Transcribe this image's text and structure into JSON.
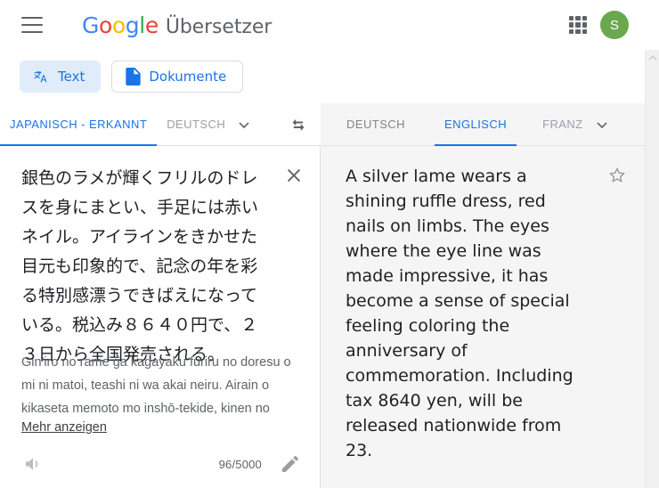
{
  "header": {
    "menu_icon": "hamburger-menu-icon",
    "logo_text": "Google",
    "logo_letters": [
      {
        "ch": "G",
        "color": "#4285f4"
      },
      {
        "ch": "o",
        "color": "#ea4335"
      },
      {
        "ch": "o",
        "color": "#fbbc05"
      },
      {
        "ch": "g",
        "color": "#4285f4"
      },
      {
        "ch": "l",
        "color": "#34a853"
      },
      {
        "ch": "e",
        "color": "#ea4335"
      }
    ],
    "product_name": "Übersetzer",
    "apps_icon": "apps-grid-icon",
    "avatar_initial": "S",
    "avatar_color": "#6aa84f"
  },
  "mode_tabs": [
    {
      "label": "Text",
      "icon": "translate-icon",
      "active": true
    },
    {
      "label": "Dokumente",
      "icon": "document-icon",
      "active": false
    }
  ],
  "source_panel": {
    "language_tabs": [
      {
        "label": "JAPANISCH - ERKANNT",
        "selected": true
      },
      {
        "label": "DEUTSCH",
        "selected": false,
        "faded": true
      }
    ],
    "dropdown_icon": "chevron-down-icon",
    "swap_icon": "swap-languages-icon",
    "text": "銀色のラメが輝くフリルのドレスを身にまとい、手足には赤いネイル。アイラインをきかせた目元も印象的で、記念の年を彩る特別感漂うできばえになっている。税込み８６４０円で、２３日から全国発売される。",
    "romanization": "Gin'iro no rame ga kagayaku furiru no doresu o mi ni matoi, teashi ni wa akai neiru. Airain o kikaseta memoto mo inshō-tekide, kinen no",
    "more_link": "Mehr anzeigen",
    "clear_icon": "close-icon",
    "listen_icon": "speaker-icon",
    "edit_icon": "pencil-icon",
    "char_counter": "96/5000"
  },
  "target_panel": {
    "language_tabs": [
      {
        "label": "DEUTSCH",
        "selected": false
      },
      {
        "label": "ENGLISCH",
        "selected": true
      },
      {
        "label": "FRANZ",
        "selected": false,
        "faded": true
      }
    ],
    "dropdown_icon": "chevron-down-icon",
    "text": "A silver lame wears a shining ruffle dress, red nails on limbs. The eyes where the eye line was made impressive, it has become a sense of special feeling coloring the anniversary of commemoration. Including tax 8640 yen, will be released nationwide from 23.",
    "star_icon": "star-outline-icon",
    "listen_icon": "speaker-icon",
    "copy_icon": "copy-icon",
    "more_icon": "more-vertical-icon"
  },
  "scrollbar": {
    "up_arrow_icon": "chevron-up-icon"
  },
  "colors": {
    "accent": "#1a73e8",
    "chip_active_bg": "#e1ecfb",
    "panel_bg": "#f5f5f5",
    "text": "#202124",
    "muted": "#5f6368"
  }
}
